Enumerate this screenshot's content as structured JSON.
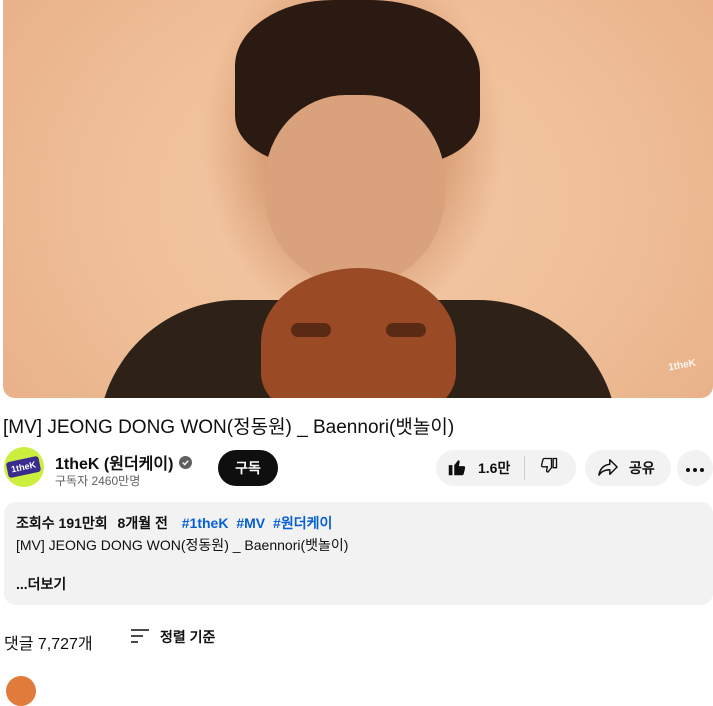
{
  "video": {
    "watermark": "1theK"
  },
  "title": "[MV] JEONG DONG WON(정동원) _ Baennori(뱃놀이)",
  "channel": {
    "avatar_text": "1theK",
    "name": "1theK (원더케이)",
    "subscribers": "구독자 2460만명",
    "subscribe_label": "구독"
  },
  "actions": {
    "like_count": "1.6만",
    "share_label": "공유"
  },
  "description": {
    "views": "조회수 191만회",
    "age": "8개월 전",
    "hashtags": [
      "#1theK",
      "#MV",
      "#원더케이"
    ],
    "text": "[MV] JEONG DONG WON(정동원) _ Baennori(뱃놀이)",
    "more_label": "...더보기"
  },
  "comments": {
    "count_label": "댓글 7,727개",
    "sort_label": "정렬 기준"
  },
  "colors": {
    "subscribe_bg": "#0f0f0f",
    "pill_bg": "#f2f2f2",
    "hashtag": "#065fd4",
    "avatar_bg": "#ccee3f"
  }
}
